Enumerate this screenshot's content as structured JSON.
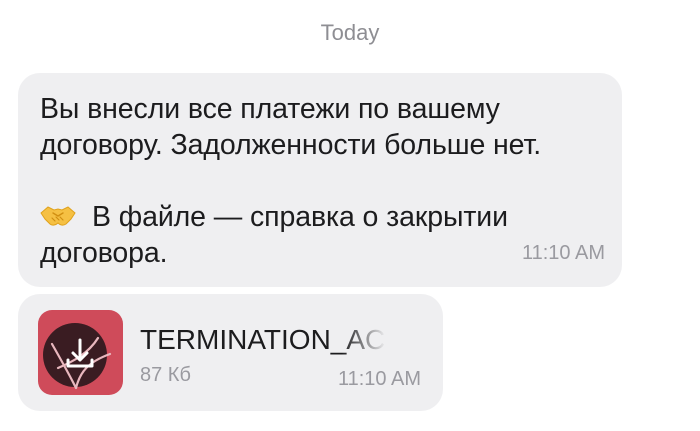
{
  "conversation": {
    "date_separator": "Today"
  },
  "messages": [
    {
      "type": "text",
      "lines": [
        "Вы внесли все платежи по вашему",
        "договору. Задолженности больше нет."
      ],
      "emoji_icon": "handshake-icon",
      "lines_after_emoji": [
        "В файле — справка о закрытии",
        "договора."
      ],
      "time": "11:10 AM"
    },
    {
      "type": "file",
      "file_name": "TERMINATION_AC",
      "file_size": "87 Кб",
      "file_icon": "pdf-download-icon",
      "time": "11:10 AM"
    }
  ],
  "colors": {
    "bubble_bg": "#efeff1",
    "file_icon_bg": "#cf4b5a",
    "text": "#1c1c1e",
    "muted": "#9a9aa0"
  }
}
